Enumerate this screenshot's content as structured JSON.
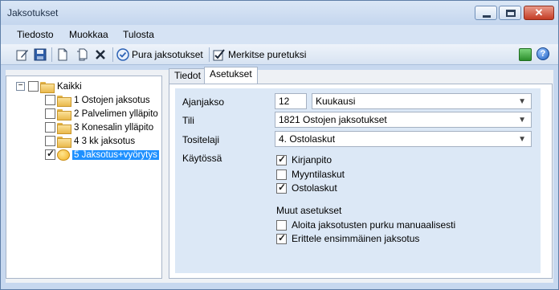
{
  "window": {
    "title": "Jaksotukset",
    "close_glyph": "✕"
  },
  "menu": {
    "items": [
      "Tiedosto",
      "Muokkaa",
      "Tulosta"
    ]
  },
  "toolbar": {
    "pura_label": "Pura jaksotukset",
    "merkitse_label": "Merkitse puretuksi",
    "help_glyph": "?"
  },
  "tree": {
    "collapse_glyph": "−",
    "root": {
      "label": "Kaikki",
      "checked": false
    },
    "items": [
      {
        "label": "1 Ostojen jaksotus",
        "checked": false
      },
      {
        "label": "2 Palvelimen ylläpito",
        "checked": false
      },
      {
        "label": "3 Konesalin ylläpito",
        "checked": false
      },
      {
        "label": "4 3 kk jaksotus",
        "checked": false
      },
      {
        "label": "5 Jaksotus+vyörytys",
        "checked": true,
        "selected": true
      }
    ]
  },
  "tabs": [
    {
      "label": "Tiedot",
      "active": false
    },
    {
      "label": "Asetukset",
      "active": true
    }
  ],
  "form": {
    "ajanjakso_label": "Ajanjakso",
    "ajanjakso_value": "12",
    "ajanjakso_unit": "Kuukausi",
    "tili_label": "Tili",
    "tili_value": "1821 Ostojen jaksotukset",
    "tositelaji_label": "Tositelaji",
    "tositelaji_value": "4. Ostolaskut",
    "kaytossa_label": "Käytössä",
    "kaytossa_options": [
      {
        "label": "Kirjanpito",
        "checked": true
      },
      {
        "label": "Myyntilaskut",
        "checked": false
      },
      {
        "label": "Ostolaskut",
        "checked": true
      }
    ],
    "muut_label": "Muut asetukset",
    "muut_options": [
      {
        "label": "Aloita jaksotusten purku manuaalisesti",
        "checked": false
      },
      {
        "label": "Erittele ensimmäinen jaksotus",
        "checked": true
      }
    ]
  }
}
